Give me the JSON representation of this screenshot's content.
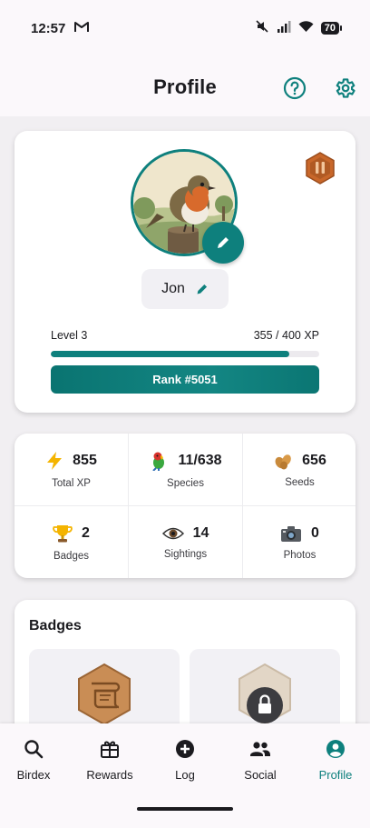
{
  "status_bar": {
    "time": "12:57",
    "battery": "70"
  },
  "header": {
    "title": "Profile"
  },
  "profile": {
    "name": "Jon",
    "level_label": "Level 3",
    "xp_text": "355 / 400 XP",
    "xp_progress": 0.8875,
    "rank_label": "Rank #5051"
  },
  "stats": [
    {
      "icon": "lightning-icon",
      "value": "855",
      "label": "Total XP"
    },
    {
      "icon": "parrot-icon",
      "value": "11/638",
      "label": "Species"
    },
    {
      "icon": "seeds-icon",
      "value": "656",
      "label": "Seeds"
    },
    {
      "icon": "trophy-icon",
      "value": "2",
      "label": "Badges"
    },
    {
      "icon": "eye-icon",
      "value": "14",
      "label": "Sightings"
    },
    {
      "icon": "camera-icon",
      "value": "0",
      "label": "Photos"
    }
  ],
  "badges": {
    "title": "Badges"
  },
  "nav": [
    {
      "label": "Birdex",
      "icon": "search-icon"
    },
    {
      "label": "Rewards",
      "icon": "gift-icon"
    },
    {
      "label": "Log",
      "icon": "add-circle-icon"
    },
    {
      "label": "Social",
      "icon": "people-icon"
    },
    {
      "label": "Profile",
      "icon": "account-icon",
      "active": true
    }
  ],
  "colors": {
    "accent": "#0e807d",
    "background": "#f1eff2",
    "card": "#ffffff"
  }
}
